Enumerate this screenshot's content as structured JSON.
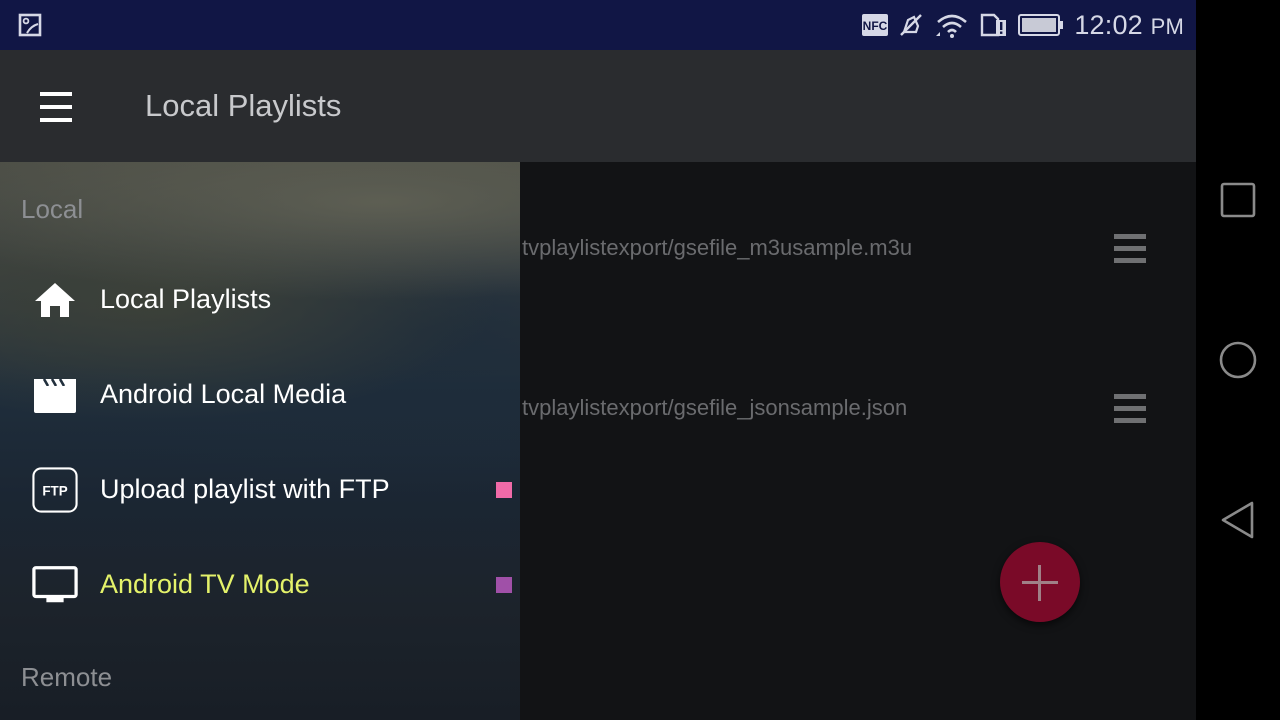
{
  "status_bar": {
    "left_icons": [
      "gallery-icon"
    ],
    "right_icons": [
      "nfc-icon",
      "vibrate-off-icon",
      "wifi-icon",
      "sim-alert-icon",
      "battery-icon"
    ],
    "nfc_text": "NFC",
    "time": "12:02",
    "ampm": "PM"
  },
  "app_bar": {
    "menu_icon": "hamburger-icon",
    "title": "Local Playlists"
  },
  "drawer": {
    "sections": [
      {
        "label": "Local",
        "items": [
          {
            "label": "Local Playlists",
            "icon": "home-icon",
            "active": false,
            "badge_color": null
          },
          {
            "label": "Android Local Media",
            "icon": "clapperboard-icon",
            "active": false,
            "badge_color": null
          },
          {
            "label": "Upload playlist with FTP",
            "icon": "ftp-icon",
            "icon_text": "FTP",
            "active": false,
            "badge_color": "#f06aa8"
          },
          {
            "label": "Android TV Mode",
            "icon": "tv-icon",
            "active": true,
            "badge_color": "#a050a8"
          }
        ]
      },
      {
        "label": "Remote",
        "items": []
      }
    ]
  },
  "playlists": [
    {
      "path": "tvplaylistexport/gsefile_m3usample.m3u",
      "action_icon": "drag-handle-icon"
    },
    {
      "path": "tvplaylistexport/gsefile_jsonsample.json",
      "action_icon": "drag-handle-icon"
    }
  ],
  "fab": {
    "icon": "plus-icon",
    "color": "#7a0a28"
  },
  "system_nav": {
    "buttons": [
      "recents-icon",
      "home-circle-icon",
      "back-icon"
    ]
  },
  "colors": {
    "status_bar": "#111645",
    "app_bar": "#2a2c2f",
    "active_item": "#e4f26a"
  }
}
